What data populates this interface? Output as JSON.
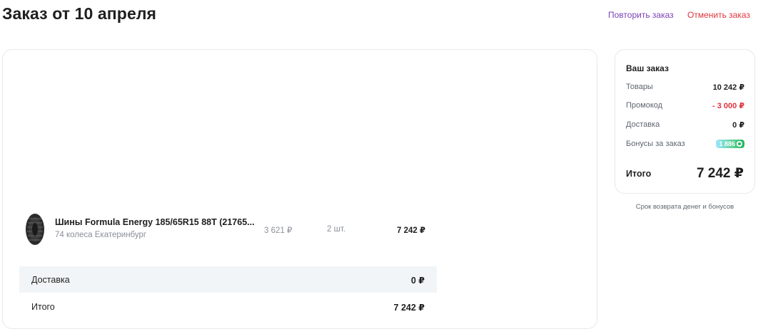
{
  "header": {
    "title": "Заказ от 10 апреля",
    "repeat_label": "Повторить заказ",
    "cancel_label": "Отменить заказ"
  },
  "order": {
    "items": [
      {
        "name": "Шины Formula Energy 185/65R15 88T (21765...",
        "seller": "74 колеса Екатеринбург",
        "unit_price": "3 621 ₽",
        "quantity": "2 шт.",
        "total": "7 242 ₽",
        "icon": "tire-icon"
      }
    ],
    "delivery": {
      "label": "Доставка",
      "value": "0 ₽"
    },
    "total": {
      "label": "Итого",
      "value": "7 242 ₽"
    }
  },
  "summary": {
    "title": "Ваш заказ",
    "rows": [
      {
        "label": "Товары",
        "value": "10 242 ₽"
      },
      {
        "label": "Промокод",
        "value": "- 3 000 ₽"
      },
      {
        "label": "Доставка",
        "value": "0 ₽"
      },
      {
        "label": "Бонусы за заказ",
        "value": "1 886"
      }
    ],
    "grand_total_label": "Итого",
    "grand_total_value": "7 242 ₽",
    "refund_link": "Срок возврата денег и бонусов"
  },
  "colors": {
    "repeat_link": "#7b3fb8",
    "cancel_link": "#e0343f",
    "promo_value": "#e0343f",
    "bonus_badge": "#22b55e"
  }
}
